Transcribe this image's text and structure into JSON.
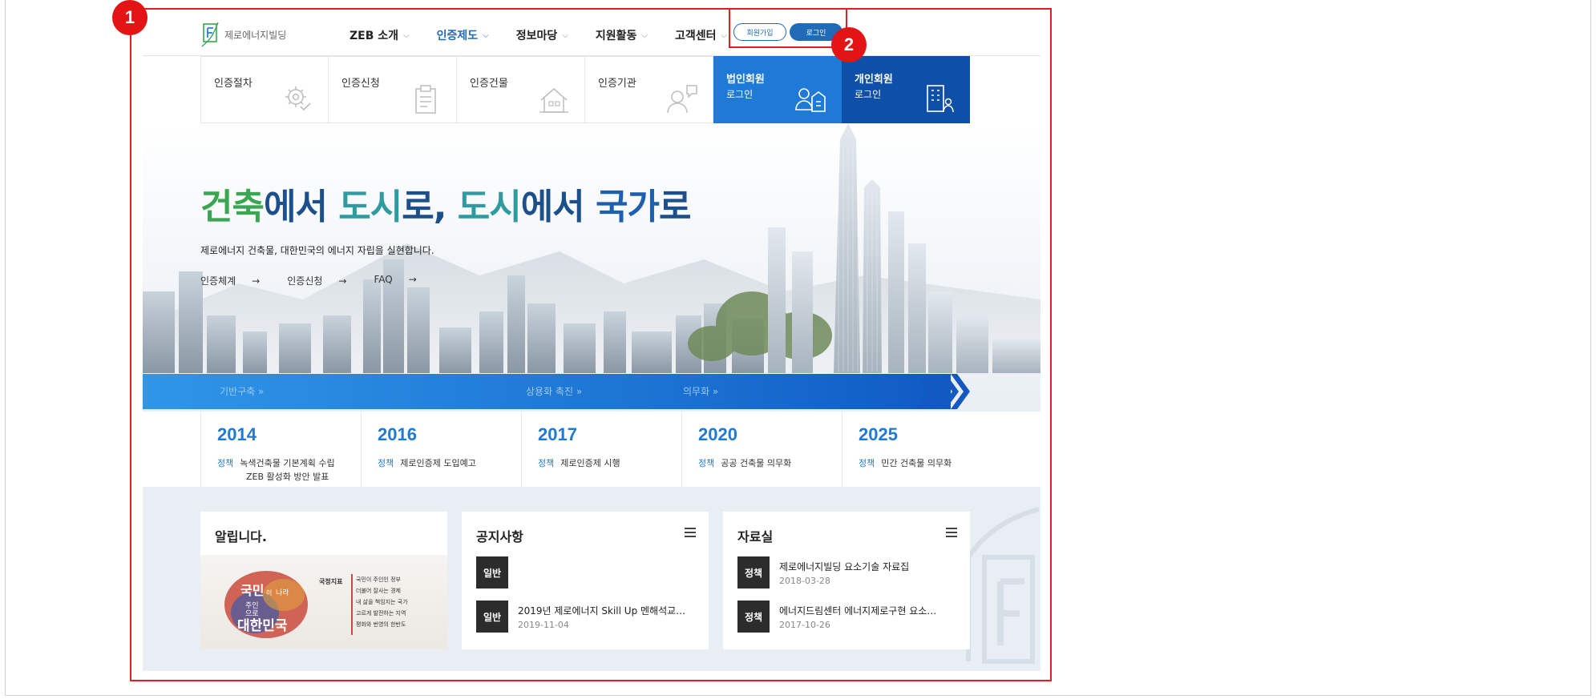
{
  "header": {
    "logo_text": "제로에너지빌딩",
    "nav": [
      {
        "label": "ZEB 소개",
        "active": false
      },
      {
        "label": "인증제도",
        "active": true
      },
      {
        "label": "정보마당",
        "active": false
      },
      {
        "label": "지원활동",
        "active": false
      },
      {
        "label": "고객센터",
        "active": false
      }
    ],
    "join_label": "회원가입",
    "login_label": "로그인"
  },
  "quick_menu": [
    {
      "label": "인증절차",
      "icon": "gear-check-icon"
    },
    {
      "label": "인증신청",
      "icon": "clipboard-icon"
    },
    {
      "label": "인증건물",
      "icon": "house-icon"
    },
    {
      "label": "인증기관",
      "icon": "person-chat-icon"
    },
    {
      "label": "법인회원",
      "sub": "로그인",
      "icon": "people-building-icon"
    },
    {
      "label": "개인회원",
      "sub": "로그인",
      "icon": "building-person-icon"
    }
  ],
  "hero": {
    "title_parts": [
      "건축",
      "에서 ",
      "도시",
      "로, ",
      "도시",
      "에서 ",
      "국가",
      "로"
    ],
    "subtitle": "제로에너지 건축물, 대한민국의 에너지 자립을 실현합니다.",
    "links": [
      "인증체계",
      "인증신청",
      "FAQ"
    ]
  },
  "timeline": {
    "stages": [
      "기반구축 »",
      "상용화 촉진 »",
      "의무화 »"
    ],
    "years": [
      {
        "year": "2014",
        "tag": "정책",
        "lines": [
          "녹색건축물 기본계획 수립",
          "ZEB 활성화 방안 발표"
        ]
      },
      {
        "year": "2016",
        "tag": "정책",
        "lines": [
          "제로인증제 도입예고"
        ]
      },
      {
        "year": "2017",
        "tag": "정책",
        "lines": [
          "제로인증제 시행"
        ]
      },
      {
        "year": "2020",
        "tag": "정책",
        "lines": [
          "공공 건축물 의무화"
        ]
      },
      {
        "year": "2025",
        "tag": "정책",
        "lines": [
          "민간 건축물 의무화"
        ]
      }
    ]
  },
  "boards": {
    "notice_banner_title": "알립니다.",
    "banner_text": {
      "brush": [
        "국민",
        "이 ",
        "나라",
        "주인",
        "으로",
        "대한민국"
      ],
      "label": "국정지표",
      "lines": [
        "국민이 주인인 정부",
        "더불어 잘사는 경제",
        "내 삶을 책임지는 국가",
        "고르게 발전하는 지역",
        "평화와 번영의 한반도"
      ]
    },
    "notices": {
      "title": "공지사항",
      "items": [
        {
          "tag": "일반",
          "title": "",
          "date": ""
        },
        {
          "tag": "일반",
          "title": "2019년 제로에너지 Skill Up 멘해석교…",
          "date": "2019-11-04"
        }
      ]
    },
    "library": {
      "title": "자료실",
      "items": [
        {
          "tag": "정책",
          "title": "제로에너지빌딩 요소기술 자료집",
          "date": "2018-03-28"
        },
        {
          "tag": "정책",
          "title": "에너지드림센터 에너지제로구현 요소…",
          "date": "2017-10-26"
        }
      ]
    }
  },
  "markers": [
    "1",
    "2"
  ],
  "colors": {
    "accent": "#1e7ad6",
    "navy": "#0e4fa8",
    "annotation": "#e02020"
  }
}
